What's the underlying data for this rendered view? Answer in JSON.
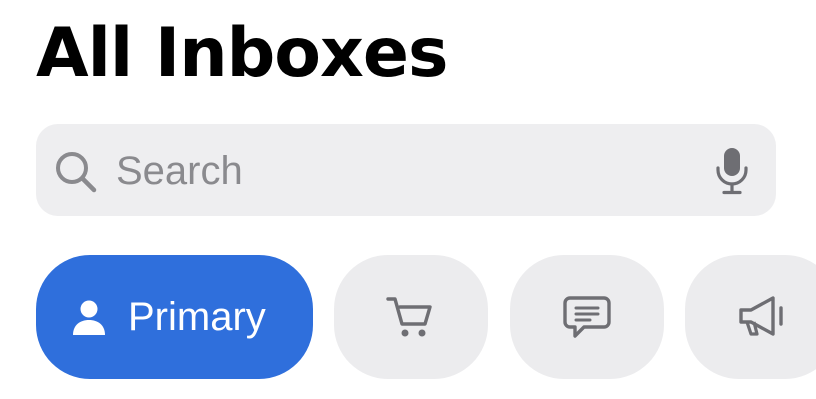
{
  "header": {
    "title": "All Inboxes"
  },
  "search": {
    "placeholder": "Search",
    "value": "",
    "left_icon": "magnifying-glass-icon",
    "right_icon": "microphone-icon"
  },
  "categories": [
    {
      "label": "Primary",
      "icon": "person-icon",
      "selected": true
    },
    {
      "label": "",
      "icon": "shopping-cart-icon",
      "selected": false
    },
    {
      "label": "",
      "icon": "chat-bubble-icon",
      "selected": false
    },
    {
      "label": "",
      "icon": "megaphone-icon",
      "selected": false
    }
  ],
  "colors": {
    "accent": "#2f6fdc",
    "chip_background": "#ececee",
    "search_background": "#eeeef0",
    "placeholder": "#8a8a8e",
    "icon_gray": "#6e6e73"
  }
}
